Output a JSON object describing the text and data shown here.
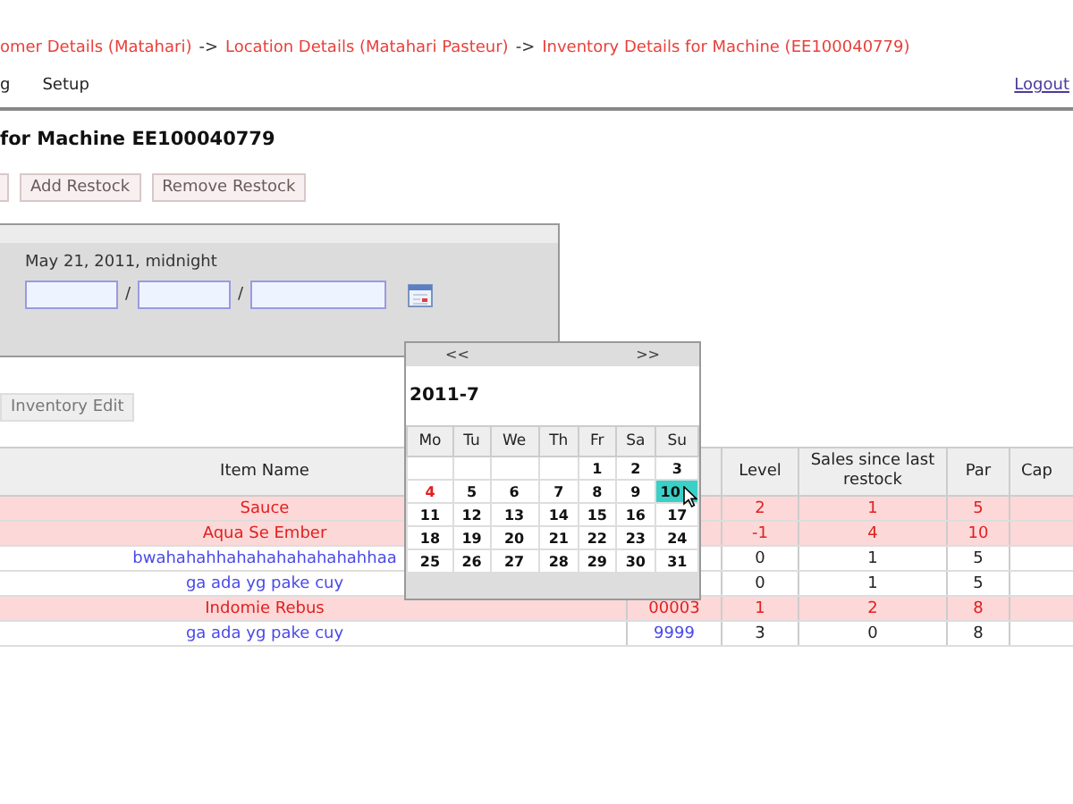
{
  "breadcrumb": [
    {
      "kind": "link",
      "text": "omer Details (Matahari)"
    },
    {
      "kind": "sep",
      "text": "->"
    },
    {
      "kind": "link",
      "text": "Location Details (Matahari Pasteur)"
    },
    {
      "kind": "sep",
      "text": "->"
    },
    {
      "kind": "link",
      "text": "Inventory Details for Machine (EE100040779)"
    }
  ],
  "nav": {
    "items": [
      "g",
      "Setup"
    ],
    "logout": "Logout"
  },
  "title": "for Machine EE100040779",
  "actions": [
    "Add Restock",
    "Remove Restock"
  ],
  "date_panel": {
    "label": "May 21, 2011, midnight",
    "separators": [
      "/",
      "/"
    ]
  },
  "calendar": {
    "prev": "<<",
    "next": ">>",
    "month": "2011-7",
    "weekdays": [
      "Mo",
      "Tu",
      "We",
      "Th",
      "Fr",
      "Sa",
      "Su"
    ],
    "weeks": [
      [
        {
          "kind": "blank"
        },
        {
          "kind": "blank"
        },
        {
          "kind": "blank"
        },
        {
          "kind": "blank"
        },
        {
          "day": "1",
          "today": false,
          "selected": false
        },
        {
          "day": "2",
          "today": false,
          "selected": false
        },
        {
          "day": "3",
          "today": false,
          "selected": false
        }
      ],
      [
        {
          "day": "4",
          "today": true,
          "selected": false
        },
        {
          "day": "5",
          "today": false,
          "selected": false
        },
        {
          "day": "6",
          "today": false,
          "selected": false
        },
        {
          "day": "7",
          "today": false,
          "selected": false
        },
        {
          "day": "8",
          "today": false,
          "selected": false
        },
        {
          "day": "9",
          "today": false,
          "selected": false
        },
        {
          "day": "10",
          "today": false,
          "selected": true
        }
      ],
      [
        {
          "day": "11",
          "today": false,
          "selected": false
        },
        {
          "day": "12",
          "today": false,
          "selected": false
        },
        {
          "day": "13",
          "today": false,
          "selected": false
        },
        {
          "day": "14",
          "today": false,
          "selected": false
        },
        {
          "day": "15",
          "today": false,
          "selected": false
        },
        {
          "day": "16",
          "today": false,
          "selected": false
        },
        {
          "day": "17",
          "today": false,
          "selected": false
        }
      ],
      [
        {
          "day": "18",
          "today": false,
          "selected": false
        },
        {
          "day": "19",
          "today": false,
          "selected": false
        },
        {
          "day": "20",
          "today": false,
          "selected": false
        },
        {
          "day": "21",
          "today": false,
          "selected": false
        },
        {
          "day": "22",
          "today": false,
          "selected": false
        },
        {
          "day": "23",
          "today": false,
          "selected": false
        },
        {
          "day": "24",
          "today": false,
          "selected": false
        }
      ],
      [
        {
          "day": "25",
          "today": false,
          "selected": false
        },
        {
          "day": "26",
          "today": false,
          "selected": false
        },
        {
          "day": "27",
          "today": false,
          "selected": false
        },
        {
          "day": "28",
          "today": false,
          "selected": false
        },
        {
          "day": "29",
          "today": false,
          "selected": false
        },
        {
          "day": "30",
          "today": false,
          "selected": false
        },
        {
          "day": "31",
          "today": false,
          "selected": false
        }
      ]
    ]
  },
  "edit_button": "Inventory Edit",
  "table": {
    "columns": [
      "Item Name",
      "",
      "Level",
      "Sales since last restock",
      "Par",
      "Cap"
    ],
    "rows": [
      {
        "alert": true,
        "cells": [
          "Sauce",
          "",
          "2",
          "1",
          "5",
          ""
        ]
      },
      {
        "alert": true,
        "cells": [
          "Aqua Se Ember",
          "",
          "-1",
          "4",
          "10",
          ""
        ]
      },
      {
        "alert": false,
        "cells": [
          "bwahahahhahahahahahahahhaa",
          "",
          "0",
          "1",
          "5",
          ""
        ]
      },
      {
        "alert": false,
        "cells": [
          "ga ada yg pake cuy",
          "",
          "0",
          "1",
          "5",
          ""
        ]
      },
      {
        "alert": true,
        "cells": [
          "Indomie Rebus",
          "00003",
          "1",
          "2",
          "8",
          ""
        ]
      },
      {
        "alert": false,
        "cells": [
          "ga ada yg pake cuy",
          "9999",
          "3",
          "0",
          "8",
          ""
        ]
      }
    ]
  }
}
